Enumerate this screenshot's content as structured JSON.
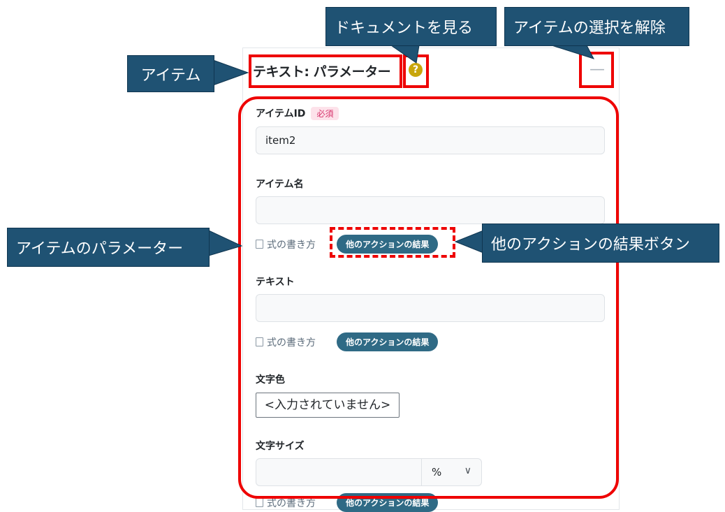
{
  "item": {
    "title": "テキスト: パラメーター",
    "help_glyph": "?",
    "deselect_glyph": "—"
  },
  "fields": {
    "item_id": {
      "label": "アイテムID",
      "required": "必須",
      "value": "item2"
    },
    "item_name": {
      "label": "アイテム名",
      "value": ""
    },
    "text": {
      "label": "テキスト",
      "value": ""
    },
    "text_color": {
      "label": "文字色",
      "value": "<入力されていません>"
    },
    "text_size": {
      "label": "文字サイズ",
      "value": "",
      "unit": "%"
    }
  },
  "helpers": {
    "formula_link": "式の書き方",
    "other_action_button": "他のアクションの結果"
  },
  "callouts": {
    "item": "アイテム",
    "docs": "ドキュメントを見る",
    "deselect": "アイテムの選択を解除",
    "params": "アイテムのパラメーター",
    "other_result": "他のアクションの結果ボタン"
  },
  "colors": {
    "highlight": "#ee0000",
    "callout_bg": "#1f5273",
    "pill_bg": "#2f6a85",
    "help_bg": "#c8a60c"
  }
}
